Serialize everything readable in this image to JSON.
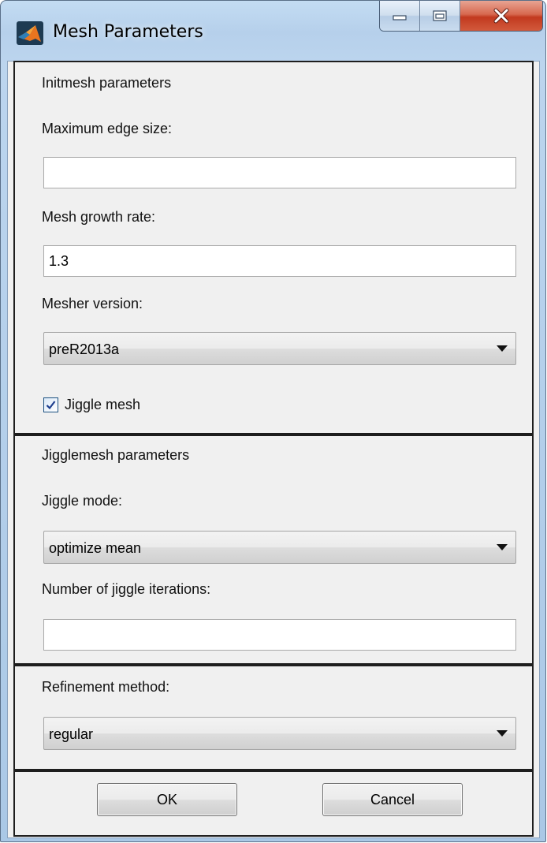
{
  "window": {
    "title": "Mesh Parameters",
    "icon": "matlab-icon",
    "controls": [
      "minimize-icon",
      "maximize-icon",
      "close-icon"
    ]
  },
  "initmesh": {
    "heading": "Initmesh parameters",
    "max_edge_label": "Maximum edge size:",
    "max_edge_value": "",
    "growth_rate_label": "Mesh growth rate:",
    "growth_rate_value": "1.3",
    "mesher_version_label": "Mesher version:",
    "mesher_version_value": "preR2013a",
    "jiggle_checkbox_label": "Jiggle mesh",
    "jiggle_checked": true
  },
  "jigglemesh": {
    "heading": "Jigglemesh parameters",
    "mode_label": "Jiggle mode:",
    "mode_value": "optimize mean",
    "iterations_label": "Number of jiggle iterations:",
    "iterations_value": ""
  },
  "refinement": {
    "label": "Refinement method:",
    "value": "regular"
  },
  "buttons": {
    "ok": "OK",
    "cancel": "Cancel"
  },
  "colors": {
    "panel_bg": "#f0f0f0",
    "border": "#1e1e1e",
    "close_red": "#c2391f",
    "title_glass": "#bcd5ee"
  }
}
